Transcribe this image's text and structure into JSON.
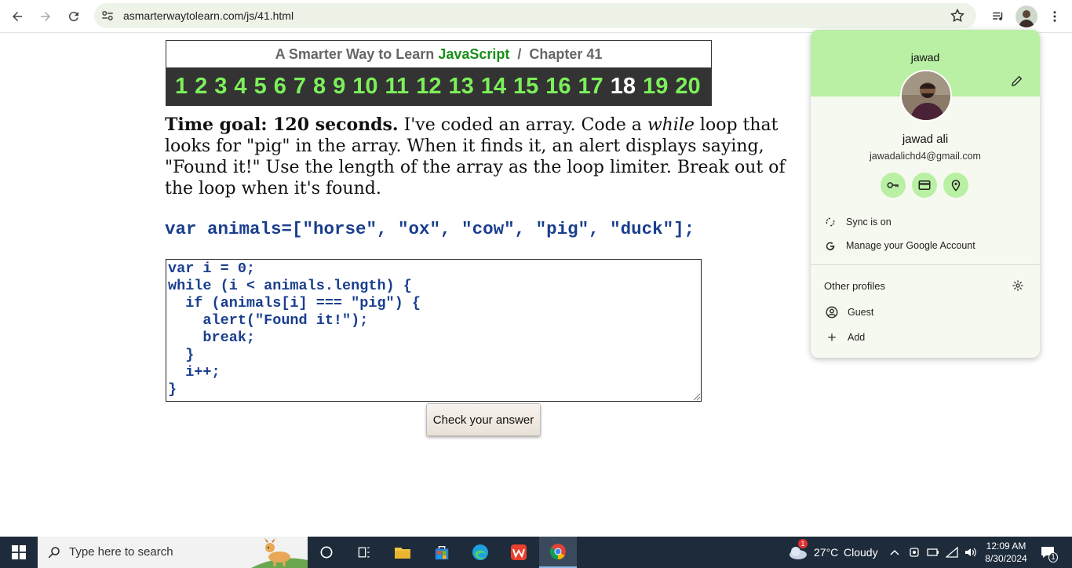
{
  "browser": {
    "url": "asmarterwaytolearn.com/js/41.html"
  },
  "page": {
    "chapter_prefix": "A Smarter Way to Learn ",
    "chapter_js": "JavaScript",
    "chapter_suffix": "  /  Chapter 41",
    "chapter_numbers": [
      "1",
      "2",
      "3",
      "4",
      "5",
      "6",
      "7",
      "8",
      "9",
      "10",
      "11",
      "12",
      "13",
      "14",
      "15",
      "16",
      "17",
      "18",
      "19",
      "20"
    ],
    "current_chapter": "18",
    "goal_bold": "Time goal: 120 seconds.",
    "instr_1": " I've coded an array. Code a ",
    "instr_italic": "while",
    "instr_2": " loop that looks for \"pig\" in the array. When it finds it, an alert displays saying, \"Found it!\" Use the length of the array as the loop limiter. Break out of the loop when it's found.",
    "code_line": "var animals=[\"horse\", \"ox\", \"cow\", \"pig\", \"duck\"];",
    "answer_code": "var i = 0;\nwhile (i < animals.length) {\n  if (animals[i] === \"pig\") {\n    alert(\"Found it!\");\n    break;\n  }\n  i++;\n}",
    "check_button": "Check your answer"
  },
  "profile": {
    "short_name": "jawad",
    "full_name": "jawad ali",
    "email": "jawadalichd4@gmail.com",
    "sync": "Sync is on",
    "manage": "Manage your Google Account",
    "other_profiles": "Other profiles",
    "guest": "Guest",
    "add": "Add"
  },
  "taskbar": {
    "search_placeholder": "Type here to search",
    "weather_temp": "27°C",
    "weather_text": "Cloudy",
    "weather_badge": "1",
    "time": "12:09 AM",
    "date": "8/30/2024",
    "notif_count": "1"
  },
  "colors": {
    "accent_green": "#1a8f1a",
    "chapter_num_green": "#7cf05a",
    "code_blue": "#1a3e8e",
    "profile_header": "#b9f0a3"
  }
}
